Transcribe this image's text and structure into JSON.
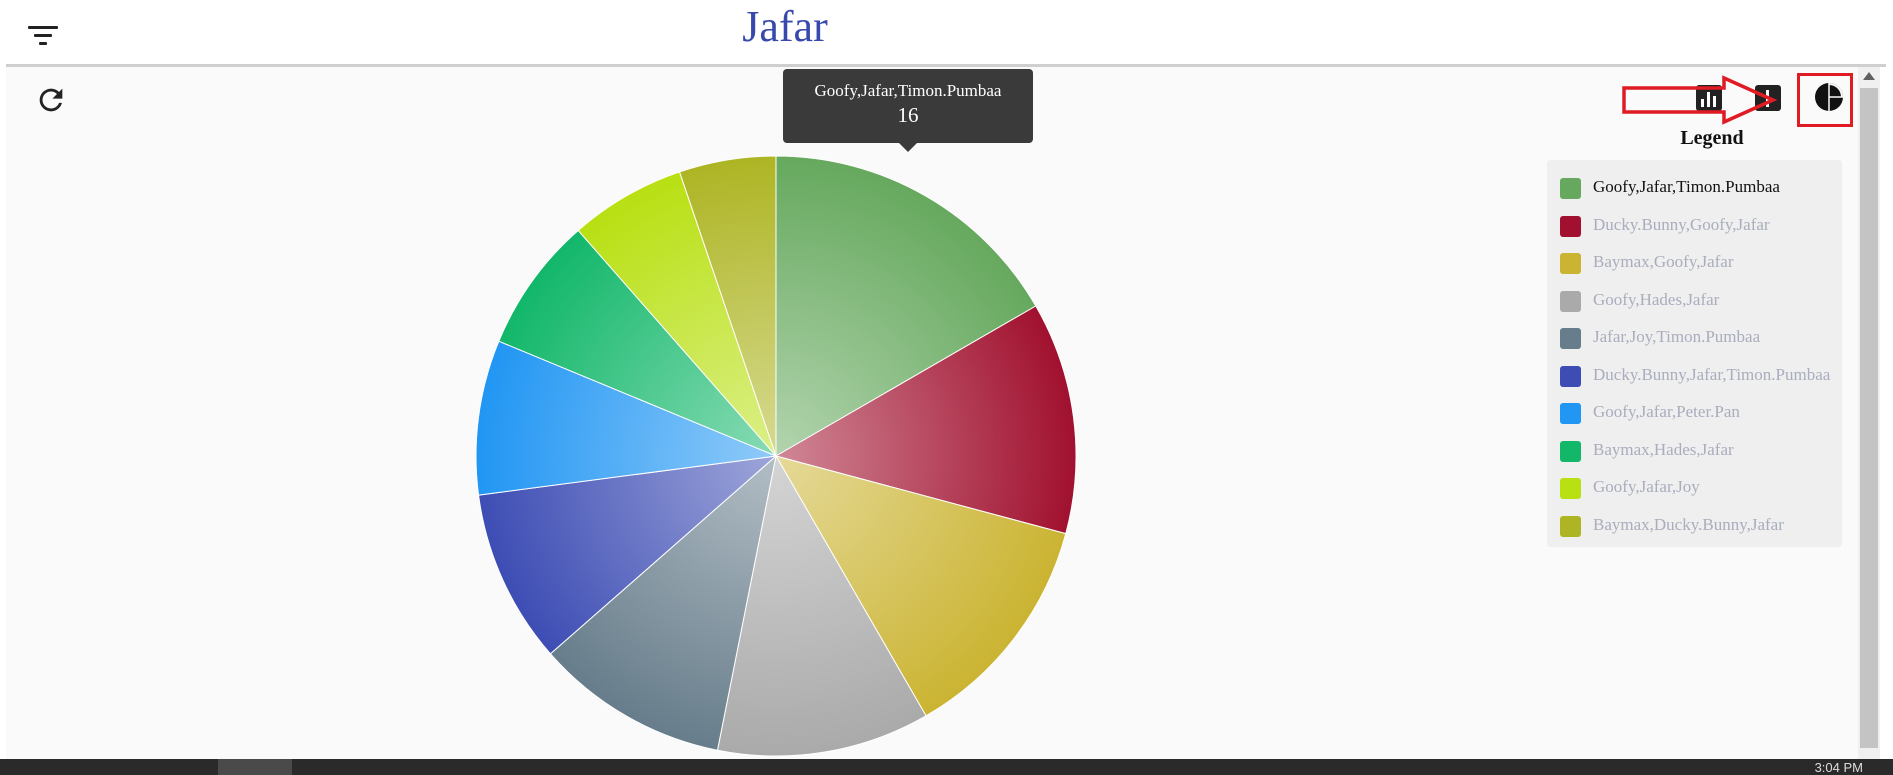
{
  "header": {
    "title": "Jafar"
  },
  "icons": {
    "menu": "menu-icon",
    "refresh": "refresh-icon",
    "bar_chart": "bar-chart-icon",
    "line_chart": "line-chart-icon",
    "pie_chart": "pie-chart-icon"
  },
  "tooltip": {
    "label": "Goofy,Jafar,Timon.Pumbaa",
    "value": "16"
  },
  "legend": {
    "title": "Legend"
  },
  "chart_data": {
    "type": "pie",
    "labels": [
      "Goofy,Jafar,Timon.Pumbaa",
      "Ducky.Bunny,Goofy,Jafar",
      "Baymax,Goofy,Jafar",
      "Goofy,Hades,Jafar",
      "Jafar,Joy,Timon.Pumbaa",
      "Ducky.Bunny,Jafar,Timon.Pumbaa",
      "Goofy,Jafar,Peter.Pan",
      "Baymax,Hades,Jafar",
      "Goofy,Jafar,Joy",
      "Baymax,Ducky.Bunny,Jafar"
    ],
    "values": [
      16,
      12,
      12,
      11,
      10,
      9,
      8,
      7,
      6,
      5
    ],
    "colors": [
      "#66a95e",
      "#a1112f",
      "#cbb432",
      "#aaaaaa",
      "#677d8b",
      "#3d4db4",
      "#2196f3",
      "#12b76a",
      "#b8e012",
      "#aeb524"
    ],
    "highlighted": 0
  },
  "taskbar": {
    "time": "3:04 PM"
  },
  "colors": {
    "accent": "#3949ab",
    "annotation": "#e01b24"
  }
}
